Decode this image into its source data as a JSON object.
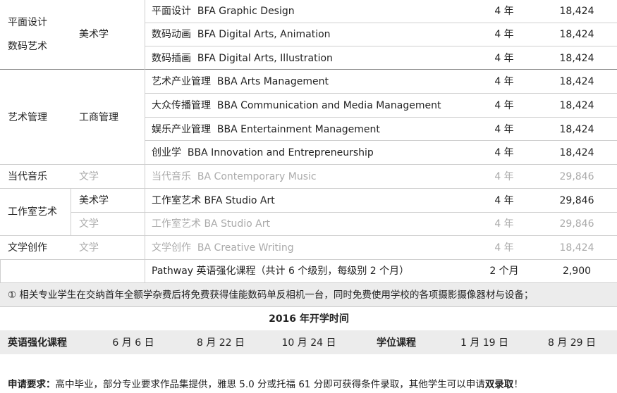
{
  "programs": {
    "rows": [
      {
        "name_cn": "平面设计",
        "name_en": "BFA Graphic Design",
        "years": "4 年",
        "fee": "18,424"
      },
      {
        "name_cn": "数码动画",
        "name_en": "BFA Digital Arts, Animation",
        "years": "4 年",
        "fee": "18,424"
      },
      {
        "name_cn": "数码插画",
        "name_en": "BFA Digital Arts, Illustration",
        "years": "4 年",
        "fee": "18,424"
      },
      {
        "name_cn": "艺术产业管理",
        "name_en": "BBA Arts Management",
        "years": "4 年",
        "fee": "18,424"
      },
      {
        "name_cn": "大众传播管理",
        "name_en": "BBA Communication and Media Management",
        "years": "4 年",
        "fee": "18,424"
      },
      {
        "name_cn": "娱乐产业管理",
        "name_en": "BBA Entertainment Management",
        "years": "4 年",
        "fee": "18,424"
      },
      {
        "name_cn": "创业学",
        "name_en": "BBA Innovation and Entrepreneurship",
        "years": "4 年",
        "fee": "18,424"
      },
      {
        "name_cn": "当代音乐",
        "name_en": "BA Contemporary Music",
        "years": "4 年",
        "fee": "29,846"
      },
      {
        "name_cn": "工作室艺术",
        "name_en": "BFA Studio Art",
        "years": "4 年",
        "fee": "29,846"
      },
      {
        "name_cn": "工作室艺术",
        "name_en": "BA Studio Art",
        "years": "4 年",
        "fee": "29,846"
      },
      {
        "name_cn": "文学创作",
        "name_en": "BA Creative Writing",
        "years": "4 年",
        "fee": "18,424"
      },
      {
        "name_cn": "Pathway 英语强化课程（共计 6 个级别，每级别 2 个月）",
        "name_en": "",
        "years": "2 个月",
        "fee": "2,900"
      }
    ],
    "categories": [
      "平面设计",
      "数码艺术",
      "艺术管理",
      "当代音乐",
      "工作室艺术",
      "文学创作"
    ],
    "degree_types": {
      "fine_arts": "美术学",
      "business": "工商管理",
      "literature": "文学"
    }
  },
  "note": "① 相关专业学生在交纳首年全额学杂费后将免费获得佳能数码单反相机一台，同时免费使用学校的各项摄影摄像器材与设备；",
  "schedule": {
    "title": "2016 年开学时间",
    "esl_label": "英语强化课程",
    "esl_dates": [
      "6 月 6 日",
      "8 月 22 日",
      "10 月 24 日"
    ],
    "degree_label": "学位课程",
    "degree_dates": [
      "1 月 19 日",
      "8 月 29 日"
    ]
  },
  "requirements": {
    "label": "申请要求：",
    "text": "高中毕业，部分专业要求作品集提供，雅思 5.0 分或托福 61 分即可获得条件录取，其他学生可以申请",
    "highlight": "双录取",
    "end": "！"
  },
  "colors": {
    "band": "#ececec",
    "rule": "#cfcfcf",
    "dim_text": "#aaaaaa",
    "text": "#222222"
  }
}
